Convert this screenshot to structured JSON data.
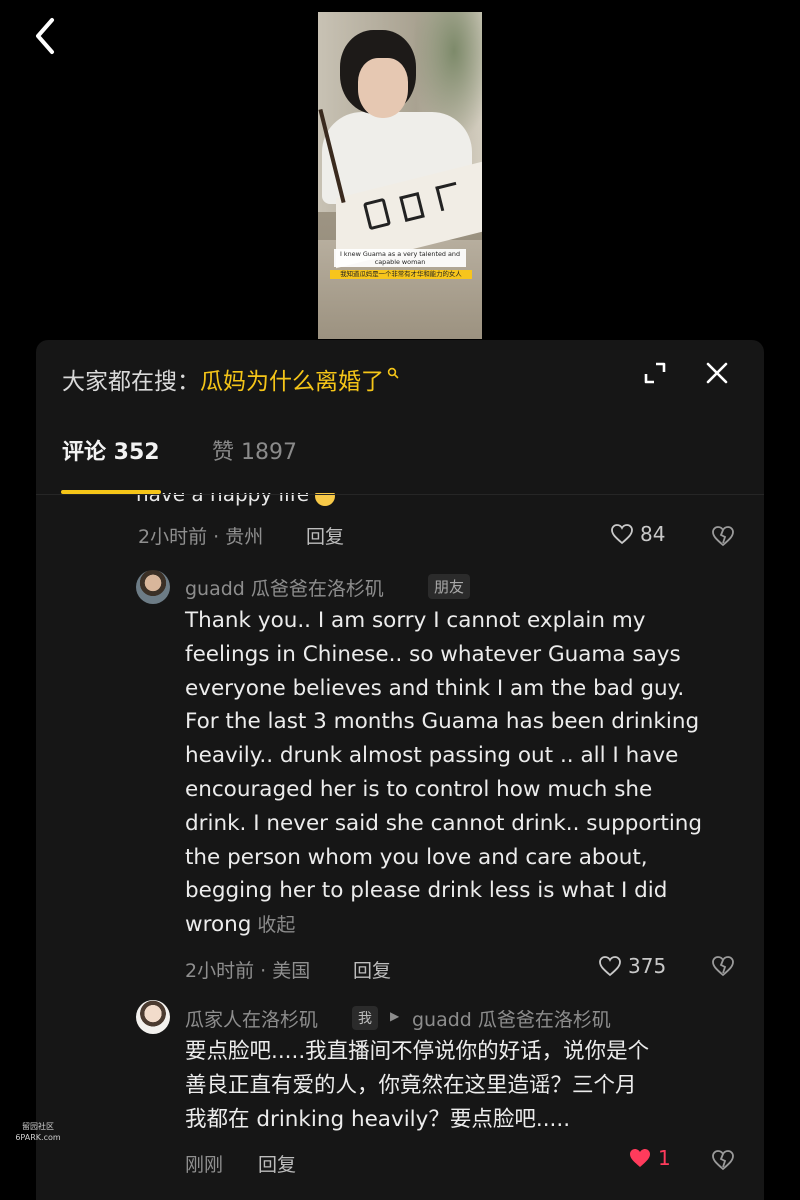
{
  "nav": {
    "back_icon": "chevron-left-icon"
  },
  "video": {
    "subtitle_en": "I knew Guama as a very talented and capable woman",
    "subtitle_zh": "我知道瓜妈是一个非常有才华和能力的女人"
  },
  "panel": {
    "search_label": "大家都在搜：",
    "search_term": "瓜妈为什么离婚了",
    "expand_icon": "expand-icon",
    "close_icon": "close-icon"
  },
  "tabs": {
    "comments": "评论 352",
    "likes": "赞 1897"
  },
  "comments": [
    {
      "text_partial": "have a happy life",
      "emoji_icon": "crying-face-icon",
      "time_location": "2小时前 · 贵州",
      "reply_label": "回复",
      "like_count": "84"
    },
    {
      "username": "guadd  瓜爸爸在洛杉矶",
      "badge": "朋友",
      "text_lines": [
        "Thank you.. I am sorry I cannot explain my",
        "feelings in Chinese.. so whatever Guama says",
        "everyone believes and think I am the bad guy.",
        "For the last 3 months Guama has been drinking",
        "heavily.. drunk almost passing out .. all I have",
        "encouraged her is to control how much she",
        "drink. I never said she cannot drink.. supporting",
        "the person whom you love and care about,",
        "begging her to please drink less is what I did",
        "wrong"
      ],
      "collapse_label": "收起",
      "time_location": "2小时前 · 美国",
      "reply_label": "回复",
      "like_count": "375"
    },
    {
      "username": "瓜家人在洛杉矶",
      "badge": "我",
      "reply_to": "guadd  瓜爸爸在洛杉矶",
      "text_lines": [
        "要点脸吧.....我直播间不停说你的好话，说你是个",
        "善良正直有爱的人，你竟然在这里造谣？三个月",
        "我都在 drinking heavily？要点脸吧....."
      ],
      "time": "刚刚",
      "reply_label": "回复",
      "like_count": "1",
      "liked": true
    }
  ],
  "watermark": {
    "line1": "留园社区",
    "line2": "6PARK.com"
  },
  "colors": {
    "accent": "#f5c518",
    "liked_heart": "#ff3b5c",
    "panel": "#161616"
  }
}
